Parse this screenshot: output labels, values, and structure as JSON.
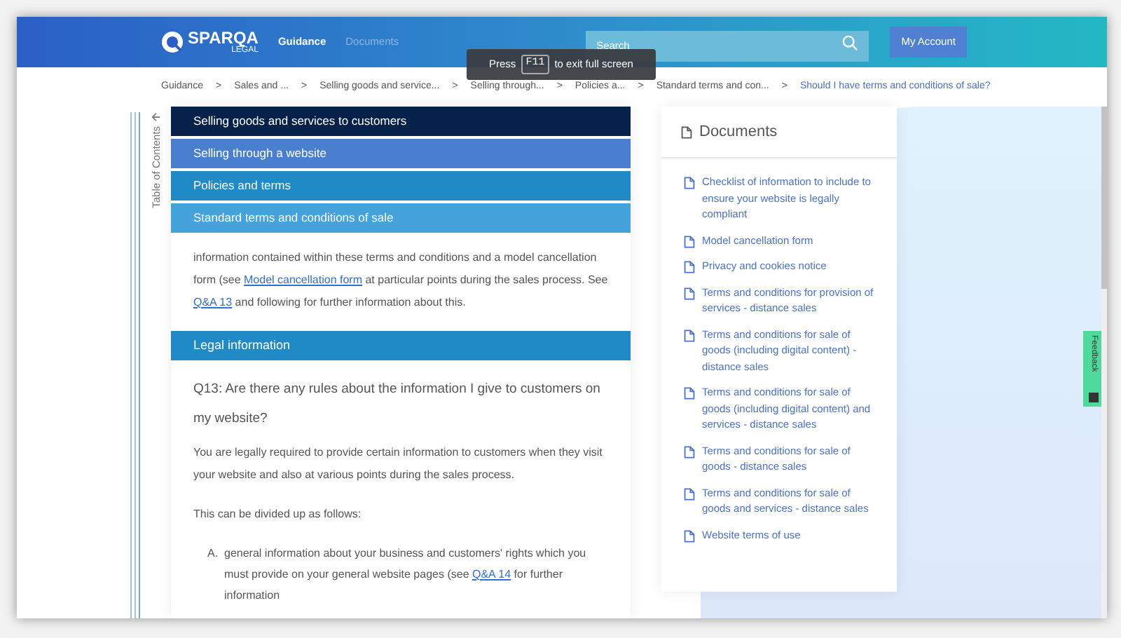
{
  "header": {
    "logo": {
      "name": "SPARQA",
      "sub": "LEGAL"
    },
    "nav": [
      {
        "label": "Guidance",
        "selected": true
      },
      {
        "label": "Documents",
        "selected": false
      }
    ],
    "search": {
      "placeholder": "Search"
    },
    "account_button": "My Account"
  },
  "fullscreen_notice": {
    "before": "Press",
    "key": "F11",
    "after": "to exit full screen"
  },
  "breadcrumbs": [
    {
      "label": "Guidance",
      "current": false
    },
    {
      "label": "Sales and ...",
      "current": false
    },
    {
      "label": "Selling goods and service...",
      "current": false
    },
    {
      "label": "Selling through...",
      "current": false
    },
    {
      "label": "Policies a...",
      "current": false
    },
    {
      "label": "Standard terms and con...",
      "current": false
    },
    {
      "label": "Should I have terms and conditions of sale?",
      "current": true
    }
  ],
  "breadcrumb_separator": ">",
  "toc_label": "Table of Contents",
  "section_bars": [
    {
      "label": "Selling goods and services to customers",
      "color": "#06214a"
    },
    {
      "label": "Selling through a website",
      "color": "#4a7fcf"
    },
    {
      "label": "Policies and terms",
      "color": "#208ac6"
    },
    {
      "label": "Standard terms and conditions of sale",
      "color": "#45a2db"
    }
  ],
  "content": [
    {
      "kind": "paragraph",
      "parts": [
        {
          "text": "information contained within these terms and conditions and a model cancellation form (see ",
          "link": false
        },
        {
          "text": "Model cancellation form",
          "link": true
        },
        {
          "text": " at particular points during the sales process. See ",
          "link": false
        },
        {
          "text": "Q&A 13",
          "link": true
        },
        {
          "text": " and following for further information about this.",
          "link": false
        }
      ]
    },
    {
      "kind": "bar",
      "text": "Legal information",
      "color": "#208ac6"
    },
    {
      "kind": "question",
      "text": "Q13: Are there any rules about the information I give to customers on my website?"
    },
    {
      "kind": "paragraph",
      "parts": [
        {
          "text": "You are legally required to provide certain information to customers when they visit your website and also at various points during the sales process.",
          "link": false
        }
      ]
    },
    {
      "kind": "paragraph",
      "parts": [
        {
          "text": "This can be divided up as follows:",
          "link": false
        }
      ]
    },
    {
      "kind": "list_item",
      "marker": "A.",
      "parts": [
        {
          "text": "general information about your business and customers' rights which you must provide on your general website pages (see ",
          "link": false
        },
        {
          "text": "Q&A 14",
          "link": true
        },
        {
          "text": " for further information",
          "link": false
        }
      ]
    }
  ],
  "documents": {
    "title": "Documents",
    "items": [
      "Checklist of information to include to ensure your website is legally compliant",
      "Model cancellation form",
      "Privacy and cookies notice",
      "Terms and conditions for provision of services - distance sales",
      "Terms and conditions for sale of goods (including digital content) - distance sales",
      "Terms and conditions for sale of goods (including digital content) and services - distance sales",
      "Terms and conditions for sale of goods - distance sales",
      "Terms and conditions for sale of goods and services - distance sales",
      "Website terms of use"
    ]
  },
  "feedback_tab": "Feedback"
}
